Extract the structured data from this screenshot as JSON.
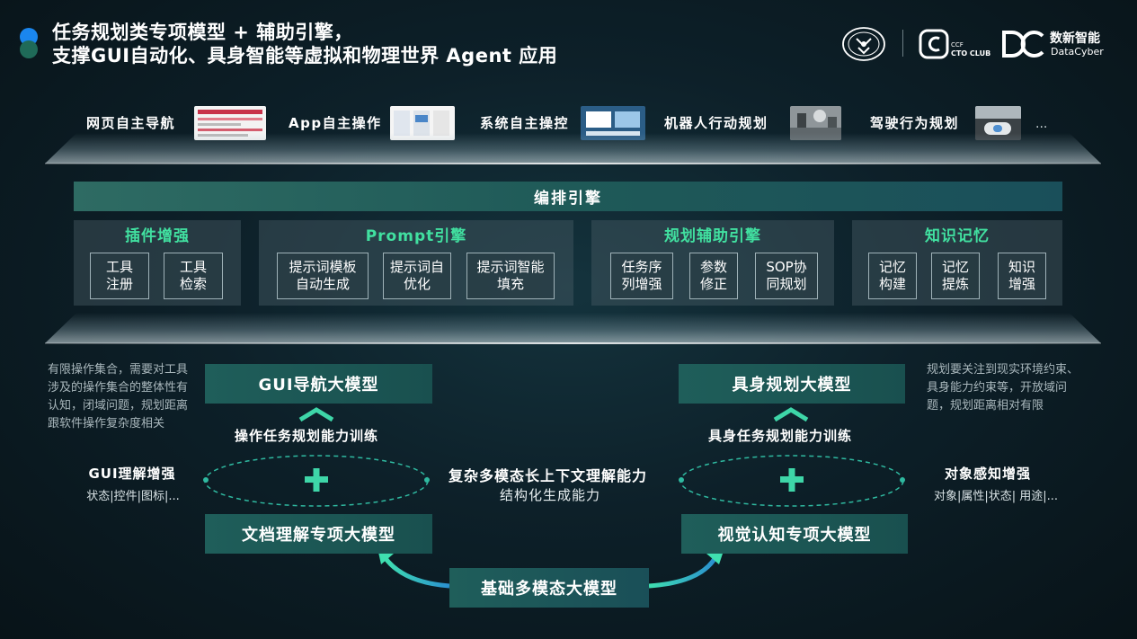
{
  "header": {
    "title_line1": "任务规划类专项模型 + 辅助引擎，",
    "title_line2": "支撑GUI自动化、具身智能等虚拟和物理世界 Agent 应用",
    "logos": {
      "ccf_seal_text": "中国计算机学会",
      "ccf_seal_abbr": "CCF",
      "cto_club_small": "CCF",
      "cto_club": "CTO CLUB",
      "dc_mark": "DC",
      "dc_name_cn": "数新智能",
      "dc_name_en": "DataCyber"
    }
  },
  "applications": [
    {
      "label": "网页自主导航",
      "icon": "webpage-screenshot"
    },
    {
      "label": "App自主操作",
      "icon": "app-screenshot"
    },
    {
      "label": "系统自主操控",
      "icon": "desktop-screenshot"
    },
    {
      "label": "机器人行动规划",
      "icon": "robot-photo"
    },
    {
      "label": "驾驶行为规划",
      "icon": "car-dashboard-photo"
    }
  ],
  "applications_more": "...",
  "orchestration": {
    "title": "编排引擎",
    "panels": [
      {
        "title": "插件增强",
        "items": [
          "工具\n注册",
          "工具\n检索"
        ]
      },
      {
        "title": "Prompt引擎",
        "items": [
          "提示词模板\n自动生成",
          "提示词自\n优化",
          "提示词智能\n填充"
        ]
      },
      {
        "title": "规划辅助引擎",
        "items": [
          "任务序\n列增强",
          "参数\n修正",
          "SOP协\n同规划"
        ]
      },
      {
        "title": "知识记忆",
        "items": [
          "记忆\n构建",
          "记忆\n提炼",
          "知识\n增强"
        ]
      }
    ]
  },
  "left_model": {
    "top": "GUI导航大模型",
    "training": "操作任务规划能力训练",
    "bottom": "文档理解专项大模型",
    "note": "有限操作集合，需要对工具涉及的操作集合的整体性有认知，闭域问题，规划距离跟软件操作复杂度相关",
    "enhance_title": "GUI理解增强",
    "enhance_sub": "状态|控件|图标|..."
  },
  "right_model": {
    "top": "具身规划大模型",
    "training": "具身任务规划能力训练",
    "bottom": "视觉认知专项大模型",
    "note": "规划要关注到现实环境约束、具身能力约束等，开放域问题，规划距离相对有限",
    "enhance_title": "对象感知增强",
    "enhance_sub": "对象|属性|状态| 用途|..."
  },
  "center": {
    "title": "复杂多模态长上下文理解能力",
    "sub": "结构化生成能力"
  },
  "base_model": "基础多模态大模型",
  "colors": {
    "accent_green": "#41e0a0",
    "teal_box": "#1f5e5a",
    "plus": "#3ed6a8",
    "dashed_ellipse": "#2fb9a0"
  }
}
